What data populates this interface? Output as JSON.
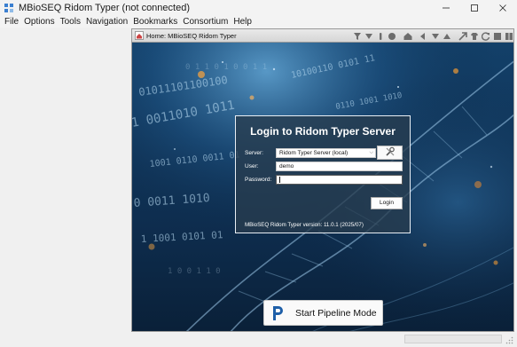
{
  "window": {
    "title": "MBioSEQ Ridom Typer (not connected)"
  },
  "menu": [
    {
      "label": "File"
    },
    {
      "label": "Options"
    },
    {
      "label": "Tools"
    },
    {
      "label": "Navigation"
    },
    {
      "label": "Bookmarks"
    },
    {
      "label": "Consortium"
    },
    {
      "label": "Help"
    }
  ],
  "pane": {
    "title": "Home: MBioSEQ Ridom Typer",
    "toolbar_icons": [
      "filter-icon",
      "filter-down-icon",
      "tube-icon",
      "shield-icon",
      "home-icon",
      "back-icon",
      "forward-icon",
      "up-icon",
      "export-icon",
      "shirt-icon",
      "refresh-icon",
      "stop-icon",
      "tile-icon"
    ]
  },
  "login": {
    "heading": "Login to Ridom Typer Server",
    "server_label": "Server:",
    "server_value": "Ridom Typer Server (local)",
    "user_label": "User:",
    "user_value": "demo",
    "password_label": "Password:",
    "password_value": "",
    "login_button": "Login",
    "version_text": "MBioSEQ Ridom Typer version: 11.0.1 (2025/07)"
  },
  "pipeline": {
    "label": "Start Pipeline Mode"
  },
  "colors": {
    "background_dark": "#0c2a47",
    "accent_blue": "#1e5fa8",
    "login_box": "#283c4e"
  }
}
